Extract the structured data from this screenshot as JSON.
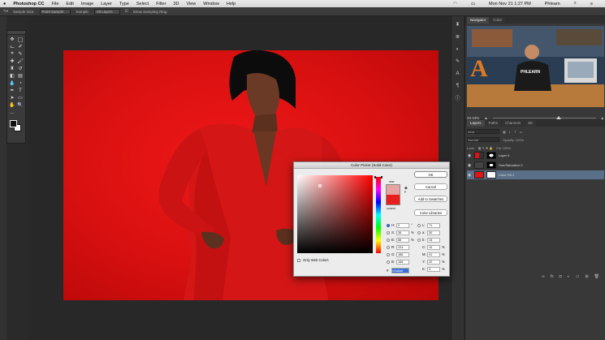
{
  "menubar": {
    "apple": "",
    "app_name": "Photoshop CC",
    "items": [
      "File",
      "Edit",
      "Image",
      "Layer",
      "Type",
      "Select",
      "Filter",
      "3D",
      "View",
      "Window",
      "Help"
    ],
    "clock": "Mon Nov 21 1:27 PM",
    "user": "Phlearn"
  },
  "options_bar": {
    "sample_size_label": "Sample Size:",
    "sample_size_value": "Point Sample",
    "sample_label": "Sample:",
    "sample_value": "All Layers",
    "show_ring_label": "Show Sampling Ring"
  },
  "navigator": {
    "tabs": [
      "Navigator",
      "Color"
    ],
    "zoom": "33.33%",
    "video_letter": "A",
    "video_shirt": "PHLEARN"
  },
  "layers_panel": {
    "tabs": [
      "Layers",
      "Paths",
      "Channels",
      "3D"
    ],
    "kind_label": "Kind",
    "mode_label": "Normal",
    "opacity_label": "Opacity: 100%",
    "lock_label": "Lock:",
    "fill_label": "Fill: 100%",
    "layers": [
      {
        "name": "Layer 0",
        "selected": false
      },
      {
        "name": "Hue/Saturation 1",
        "selected": false
      },
      {
        "name": "Color Fill 1",
        "selected": true
      }
    ]
  },
  "color_picker": {
    "title": "Color Picker (Solid Color)",
    "new_label": "new",
    "current_label": "current",
    "buttons": {
      "ok": "OK",
      "cancel": "Cancel",
      "add_swatches": "Add to Swatches",
      "libraries": "Color Libraries"
    },
    "only_web_colors": "Only Web Colors",
    "fields": [
      {
        "left_label": "H:",
        "left_value": "0",
        "left_unit": "°",
        "right_label": "L:",
        "right_value": "71",
        "right_unit": ""
      },
      {
        "left_label": "S:",
        "left_value": "36",
        "left_unit": "%",
        "right_label": "a:",
        "right_value": "30",
        "right_unit": ""
      },
      {
        "left_label": "B:",
        "left_value": "88",
        "left_unit": "%",
        "right_label": "b:",
        "right_value": "15",
        "right_unit": ""
      },
      {
        "left_label": "R:",
        "left_value": "224",
        "left_unit": "",
        "right_label": "C:",
        "right_value": "10",
        "right_unit": "%"
      },
      {
        "left_label": "G:",
        "left_value": "166",
        "left_unit": "",
        "right_label": "M:",
        "right_value": "41",
        "right_unit": "%"
      },
      {
        "left_label": "B:",
        "left_value": "166",
        "left_unit": "",
        "right_label": "Y:",
        "right_value": "22",
        "right_unit": "%"
      },
      {
        "left_label": "",
        "left_value": "",
        "left_unit": "",
        "right_label": "K:",
        "right_value": "0",
        "right_unit": "%"
      }
    ],
    "hex_label": "#",
    "hex_value": "e0a6a6",
    "new_color": "#e6a3a3",
    "current_color": "#ea1d1d"
  },
  "colors": {
    "background_red": "#dd1111",
    "dress_red": "#d81818",
    "accent_blue": "#3a6fd8"
  }
}
